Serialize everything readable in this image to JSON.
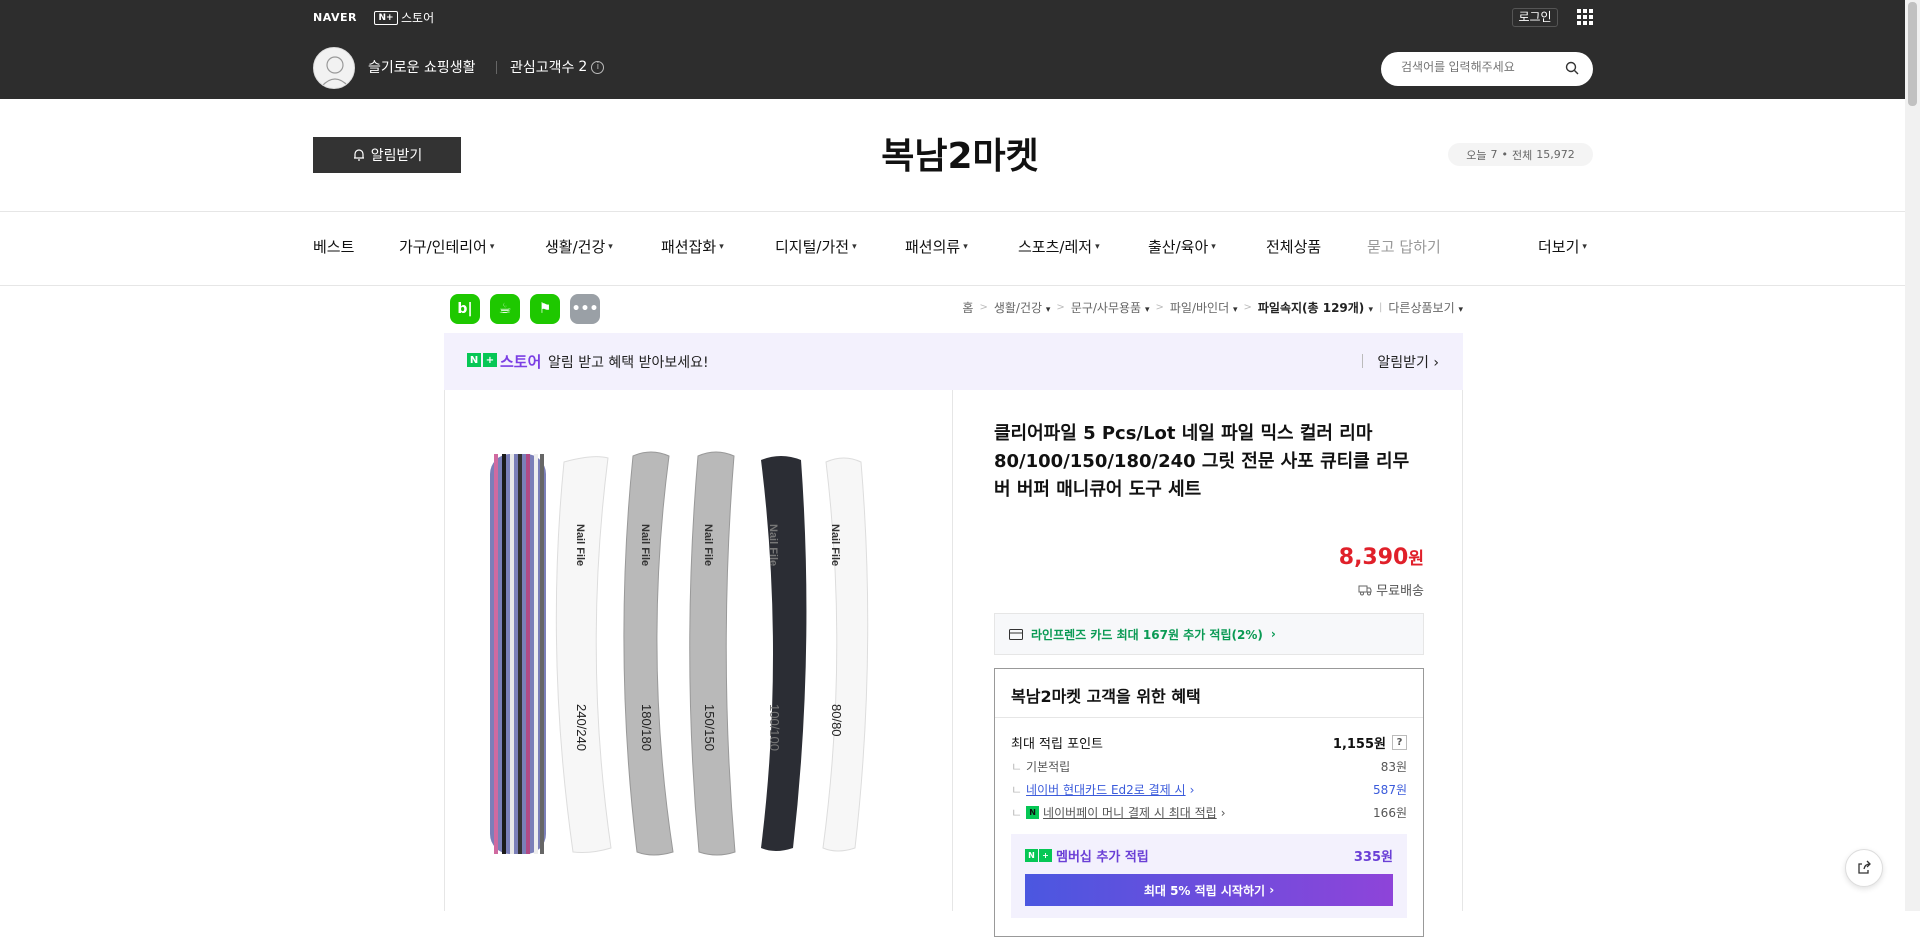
{
  "header": {
    "naver_logo": "NAVER",
    "nplus_badge": "N+",
    "store_label": "스토어",
    "login": "로그인",
    "store_name": "슬기로운 쇼핑생활",
    "fav_label": "관심고객수",
    "fav_count": "2",
    "search_placeholder": "검색어를 입력해주세요"
  },
  "store": {
    "alarm_button": "알림받기",
    "title": "복남2마켓",
    "today_label": "오늘",
    "today_count": "7",
    "total_label": "전체",
    "total_count": "15,972"
  },
  "nav": {
    "items": [
      "베스트",
      "가구/인테리어",
      "생활/건강",
      "패션잡화",
      "디지털/가전",
      "패션의류",
      "스포츠/레저",
      "출산/육아",
      "전체상품",
      "묻고 답하기",
      "더보기"
    ]
  },
  "share_icons": [
    "blog-icon",
    "cafe-icon",
    "bookmark-icon",
    "more-icon"
  ],
  "breadcrumb": {
    "items": [
      "홈",
      "생활/건강",
      "문구/사무용품",
      "파일/바인더",
      "파일속지(총 129개)",
      "다른상품보기"
    ]
  },
  "banner": {
    "store_word": "스토어",
    "message": "알림 받고 혜택 받아보세요!",
    "action": "알림받기"
  },
  "product": {
    "title": "클리어파일 5 Pcs/Lot 네일 파일 믹스 컬러 리마 80/100/150/180/240 그릿 전문 사포 큐티클 리무버 버퍼 매니큐어 도구 세트",
    "price": "8,390",
    "price_unit": "원",
    "shipping": "무료배송",
    "card_benefit": "라인프렌즈 카드 최대 167원 추가 적립(2%)",
    "file_labels": [
      "Nail File",
      "240/240",
      "180/180",
      "150/150",
      "100/100",
      "80/80"
    ]
  },
  "benefit": {
    "head": "복남2마켓 고객을 위한 혜택",
    "max_points_label": "최대 적립 포인트",
    "max_points_value": "1,155원",
    "base_label": "기본적립",
    "base_value": "83원",
    "hyundai_label": "네이버 현대카드 Ed2로 결제 시",
    "hyundai_value": "587원",
    "npay_label": "네이버페이 머니 결제 시 최대 적립",
    "npay_value": "166원",
    "member_label": "멤버십 추가 적립",
    "member_value": "335원",
    "member_button": "최대 5% 적립 시작하기"
  },
  "colors": {
    "price_red": "#e0202a",
    "accent_purple": "#7b3fe4",
    "green": "#06c755"
  }
}
